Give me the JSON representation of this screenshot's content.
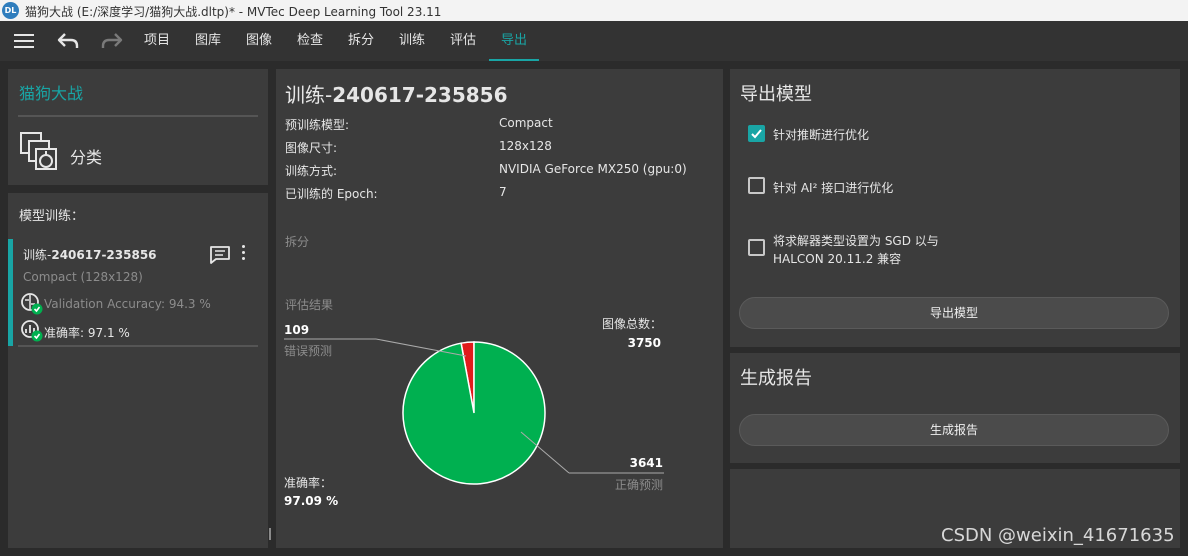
{
  "titlebar": {
    "logo": "DL",
    "title": "猫狗大战 (E:/深度学习/猫狗大战.dltp)* - MVTec Deep Learning Tool 23.11"
  },
  "menu": {
    "items": [
      "项目",
      "图库",
      "图像",
      "检查",
      "拆分",
      "训练",
      "评估",
      "导出"
    ],
    "active": "导出"
  },
  "project": {
    "name": "猫狗大战",
    "task_type": "分类"
  },
  "training_list": {
    "header": "模型训练：",
    "item": {
      "name_prefix": "训练-",
      "name_id": "240617-235856",
      "model": "Compact (128x128)",
      "validation": "Validation Accuracy: 94.3 %",
      "accuracy": "准确率: 97.1 %"
    }
  },
  "training_detail": {
    "title_prefix": "训练-",
    "title_id": "240617-235856",
    "rows": [
      {
        "label": "预训练模型:",
        "value": "Compact"
      },
      {
        "label": "图像尺寸:",
        "value": "128x128"
      },
      {
        "label": "训练方式:",
        "value": "NVIDIA GeForce MX250 (gpu:0)"
      },
      {
        "label": "已训练的 Epoch:",
        "value": "7"
      }
    ],
    "split_label": "拆分",
    "eval_label": "评估结果"
  },
  "chart_data": {
    "type": "pie",
    "slices": [
      {
        "label": "错误预测",
        "value": 109,
        "color": "#e01b1b"
      },
      {
        "label": "正确预测",
        "value": 3641,
        "color": "#00b050"
      }
    ],
    "total_label": "图像总数：",
    "total_value": "3750",
    "accuracy_label": "准确率：",
    "accuracy_value": "97.09 %"
  },
  "export_panel": {
    "title": "导出模型",
    "options": [
      {
        "label": "针对推断进行优化",
        "checked": true
      },
      {
        "label": "针对 AI² 接口进行优化",
        "checked": false
      },
      {
        "label_line1": "将求解器类型设置为 SGD 以与",
        "label_line2": "HALCON 20.11.2 兼容",
        "checked": false
      }
    ],
    "button": "导出模型"
  },
  "report_panel": {
    "title": "生成报告",
    "button": "生成报告"
  },
  "watermark": "CSDN @weixin_41671635",
  "colors": {
    "accent": "#19a5a5",
    "correct": "#00b050",
    "wrong": "#e01b1b",
    "panel": "#3c3c3c",
    "background": "#2b2b2b"
  }
}
